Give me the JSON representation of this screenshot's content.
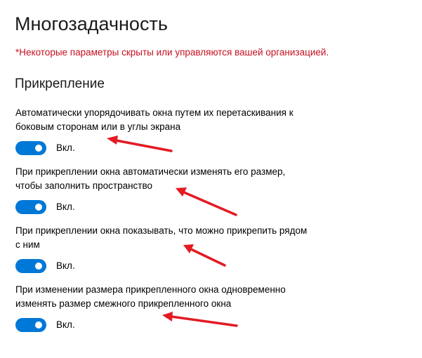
{
  "page": {
    "title": "Многозадачность",
    "org_warning": "*Некоторые параметры скрыты или управляются вашей организацией."
  },
  "section": {
    "title": "Прикрепление"
  },
  "settings": [
    {
      "line1": "Автоматически упорядочивать окна путем их перетаскивания к",
      "line2": "боковым сторонам или в углы экрана",
      "state_label": "Вкл.",
      "enabled": true
    },
    {
      "line1": "При прикреплении окна автоматически изменять его размер,",
      "line2": "чтобы заполнить пространство",
      "state_label": "Вкл.",
      "enabled": true
    },
    {
      "line1": "При прикреплении окна показывать, что можно прикрепить рядом",
      "line2": "с ним",
      "state_label": "Вкл.",
      "enabled": true
    },
    {
      "line1": "При изменении размера прикрепленного окна одновременно",
      "line2": "изменять размер смежного прикрепленного окна",
      "state_label": "Вкл.",
      "enabled": true
    }
  ],
  "colors": {
    "accent": "#0078d7",
    "warning": "#c50f1f",
    "annotation_arrow": "#e31b23"
  }
}
